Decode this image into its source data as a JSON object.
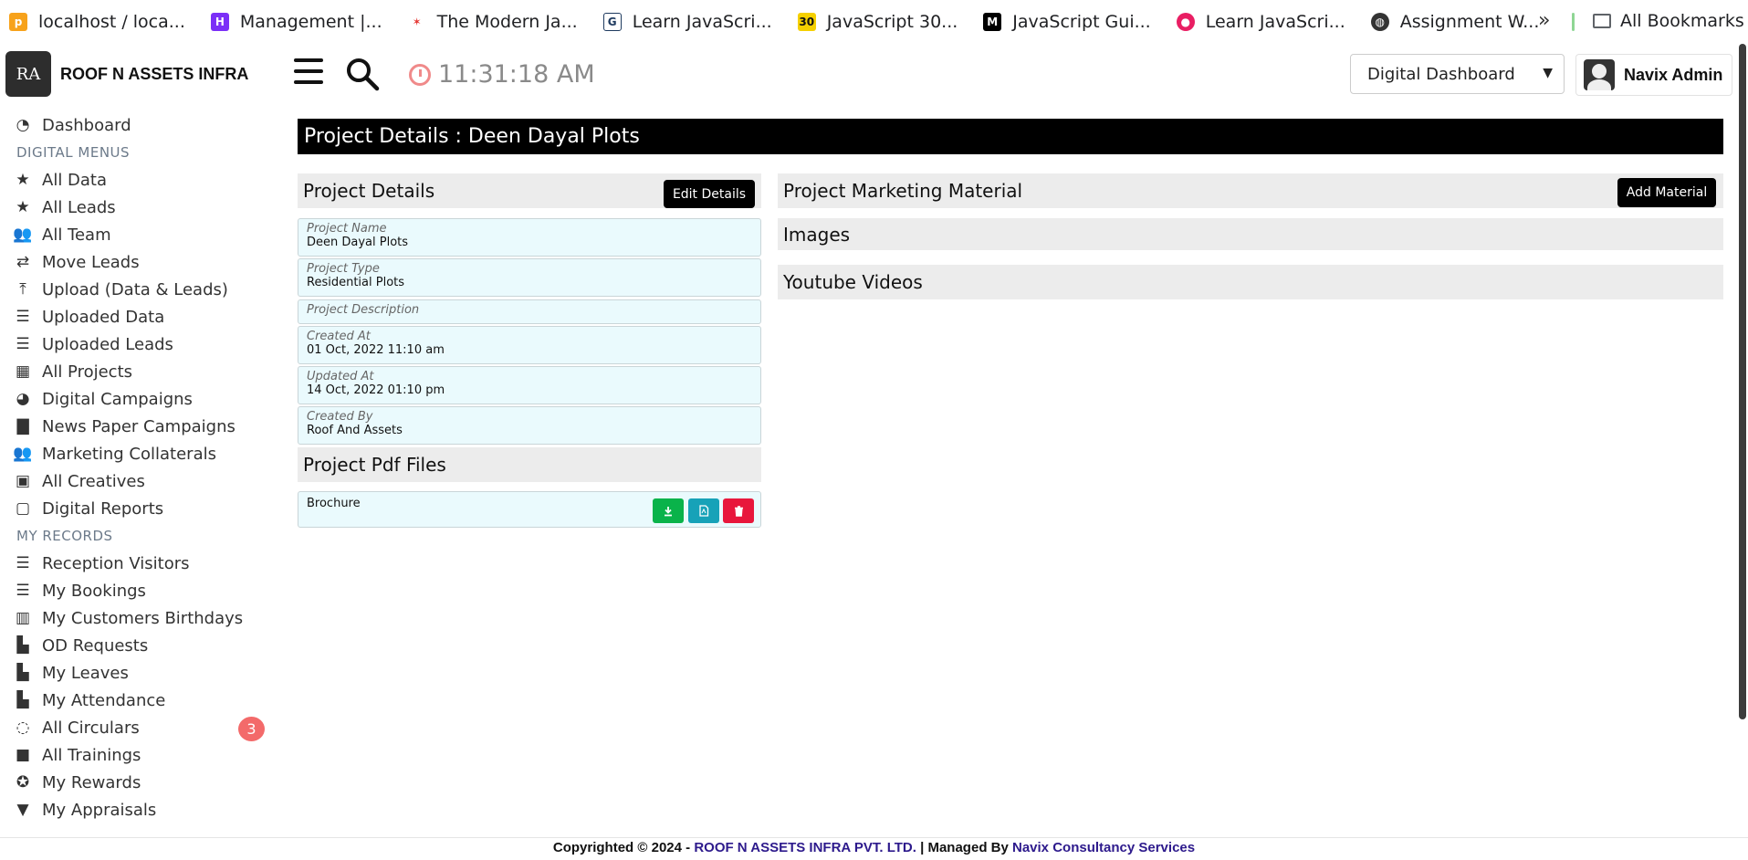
{
  "bookmarks": [
    {
      "label": "localhost / loca...",
      "icon": "phpmyadmin-icon",
      "color": "#f7a21b"
    },
    {
      "label": "Management |...",
      "icon": "h-logo-icon",
      "color": "#7b2ff7"
    },
    {
      "label": "The Modern Ja...",
      "icon": "figure-icon",
      "color": "#e53935"
    },
    {
      "label": "Learn JavaScri...",
      "icon": "doc-icon",
      "color": "#1e3a5f"
    },
    {
      "label": "JavaScript 30...",
      "icon": "thirty-icon",
      "color": "#f5d000"
    },
    {
      "label": "JavaScript Gui...",
      "icon": "m-logo-icon",
      "color": "#000000"
    },
    {
      "label": "Learn JavaScri...",
      "icon": "record-icon",
      "color": "#e91e63"
    },
    {
      "label": "Assignment W...",
      "icon": "globe-icon",
      "color": "#333333"
    }
  ],
  "bookmarks_more": "»",
  "all_bookmarks": "All Bookmarks",
  "brand": {
    "logo_text": "RA",
    "name": "ROOF N ASSETS INFRA"
  },
  "clock": "11:31:18 AM",
  "dashboard_select": {
    "value": "Digital Dashboard"
  },
  "user": {
    "name": "Navix Admin"
  },
  "sidebar": {
    "dashboard": "Dashboard",
    "digital_heading": "DIGITAL MENUS",
    "digital": [
      {
        "label": "All Data",
        "icon": "star-icon"
      },
      {
        "label": "All Leads",
        "icon": "star-icon"
      },
      {
        "label": "All Team",
        "icon": "users-icon"
      },
      {
        "label": "Move Leads",
        "icon": "exchange-icon"
      },
      {
        "label": "Upload (Data & Leads)",
        "icon": "upload-icon"
      },
      {
        "label": "Uploaded Data",
        "icon": "list-icon"
      },
      {
        "label": "Uploaded Leads",
        "icon": "list-icon"
      },
      {
        "label": "All Projects",
        "icon": "table-icon"
      },
      {
        "label": "Digital Campaigns",
        "icon": "palette-icon"
      },
      {
        "label": "News Paper Campaigns",
        "icon": "file-icon"
      },
      {
        "label": "Marketing Collaterals",
        "icon": "users-icon"
      },
      {
        "label": "All Creatives",
        "icon": "image-icon"
      },
      {
        "label": "Digital Reports",
        "icon": "pdf-icon"
      }
    ],
    "records_heading": "MY RECORDS",
    "records": [
      {
        "label": "Reception Visitors",
        "icon": "list-icon"
      },
      {
        "label": "My Bookings",
        "icon": "list-icon"
      },
      {
        "label": "My Customers Birthdays",
        "icon": "cake-icon"
      },
      {
        "label": "OD Requests",
        "icon": "door-icon"
      },
      {
        "label": "My Leaves",
        "icon": "door-icon"
      },
      {
        "label": "My Attendance",
        "icon": "door-icon"
      },
      {
        "label": "All Circulars",
        "icon": "circle-notch-icon"
      },
      {
        "label": "All Trainings",
        "icon": "video-icon"
      },
      {
        "label": "My Rewards",
        "icon": "medal-icon"
      },
      {
        "label": "My Appraisals",
        "icon": "filter-icon"
      }
    ],
    "circulars_badge": "3"
  },
  "page_title": "Project Details : Deen Dayal Plots",
  "project_details": {
    "heading": "Project Details",
    "edit_button": "Edit Details",
    "fields": [
      {
        "label": "Project Name",
        "value": "Deen Dayal Plots"
      },
      {
        "label": "Project Type",
        "value": "Residential Plots"
      },
      {
        "label": "Project Description",
        "value": ""
      },
      {
        "label": "Created At",
        "value": "01 Oct, 2022 11:10 am"
      },
      {
        "label": "Updated At",
        "value": "14 Oct, 2022 01:10 pm"
      },
      {
        "label": "Created By",
        "value": "Roof And Assets"
      }
    ]
  },
  "pdf_files": {
    "heading": "Project Pdf Files",
    "files": [
      {
        "name": "Brochure"
      }
    ]
  },
  "marketing": {
    "heading": "Project Marketing Material",
    "add_button": "Add Material",
    "images_heading": "Images",
    "videos_heading": "Youtube Videos"
  },
  "footer": {
    "prefix": "Copyrighted © 2024 - ",
    "company": "ROOF N ASSETS INFRA PVT. LTD.",
    "middle": " | Managed By ",
    "manager": "Navix Consultancy Services"
  },
  "colors": {
    "download": "#0ab34a",
    "view": "#17a2b8",
    "delete": "#e8173c",
    "badge": "#f36a6a",
    "footer_link": "#2d1a8c"
  }
}
